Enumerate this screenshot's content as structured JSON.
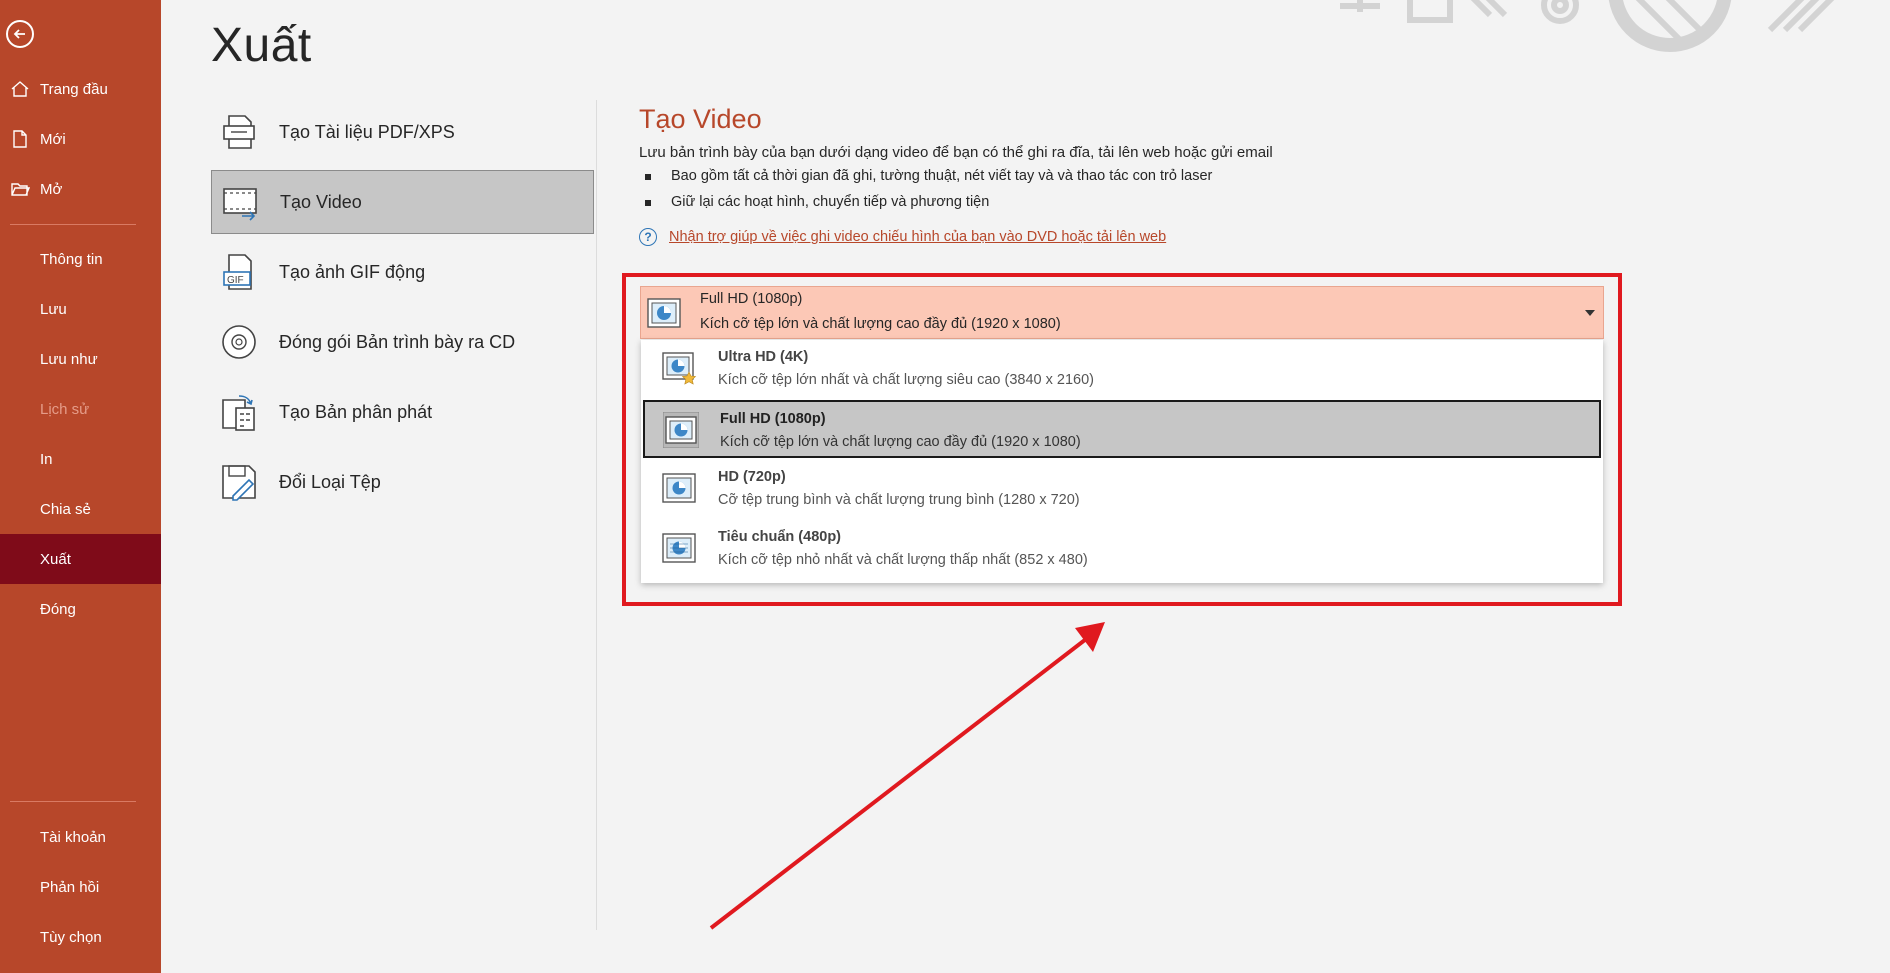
{
  "sidebar": {
    "back_label": "",
    "items": [
      {
        "label": "Trang đầu",
        "icon": "home-icon"
      },
      {
        "label": "Mới",
        "icon": "new-file-icon"
      },
      {
        "label": "Mở",
        "icon": "folder-open-icon"
      },
      {
        "label": "Thông tin"
      },
      {
        "label": "Lưu"
      },
      {
        "label": "Lưu như"
      },
      {
        "label": "Lịch sử",
        "disabled": true
      },
      {
        "label": "In"
      },
      {
        "label": "Chia sẻ"
      },
      {
        "label": "Xuất",
        "active": true
      },
      {
        "label": "Đóng"
      },
      {
        "label": "Tài khoản"
      },
      {
        "label": "Phản hồi"
      },
      {
        "label": "Tùy chọn"
      }
    ]
  },
  "page": {
    "title": "Xuất"
  },
  "export_options": [
    {
      "label": "Tạo Tài liệu PDF/XPS",
      "icon": "pdf-document-icon"
    },
    {
      "label": "Tạo Video",
      "icon": "video-icon",
      "selected": true
    },
    {
      "label": "Tạo ảnh GIF động",
      "icon": "gif-icon"
    },
    {
      "label": "Đóng gói Bản trình bày ra CD",
      "icon": "cd-icon"
    },
    {
      "label": "Tạo Bản phân phát",
      "icon": "handouts-icon"
    },
    {
      "label": "Đổi Loại Tệp",
      "icon": "change-file-type-icon"
    }
  ],
  "detail": {
    "title": "Tạo Video",
    "description": "Lưu bản trình bày của bạn dưới dạng video để bạn có thể ghi ra đĩa, tải lên web hoặc gửi email",
    "bullets": [
      "Bao gồm tất cả thời gian đã ghi, tường thuật, nét viết tay và và thao tác con trỏ laser",
      "Giữ lại các hoạt hình, chuyển tiếp và phương tiện"
    ],
    "help_link": "Nhận trợ giúp về việc ghi video chiếu hình của bạn vào DVD hoặc tải lên web"
  },
  "quality_dropdown": {
    "selected_title": "Full HD (1080p)",
    "selected_desc": "Kích cỡ tệp lớn và chất lượng cao đầy đủ (1920 x 1080)",
    "options": [
      {
        "title": "Ultra HD (4K)",
        "desc": "Kích cỡ tệp lớn nhất và chất lượng siêu cao (3840 x 2160)",
        "icon": "ultra-hd-icon"
      },
      {
        "title": "Full HD (1080p)",
        "desc": "Kích cỡ tệp lớn và chất lượng cao đầy đủ (1920 x 1080)",
        "icon": "full-hd-icon",
        "selected": true
      },
      {
        "title": "HD (720p)",
        "desc": "Cỡ tệp trung bình và chất lượng trung bình (1280 x 720)",
        "icon": "hd-icon"
      },
      {
        "title": "Tiêu chuẩn (480p)",
        "desc": "Kích cỡ tệp nhỏ nhất và chất lượng thấp nhất (852 x 480)",
        "icon": "standard-icon"
      }
    ]
  },
  "colors": {
    "sidebar_bg": "#b7472a",
    "sidebar_active": "#7f0b19",
    "accent": "#b7472a",
    "highlight_border": "#e0191f",
    "combo_bg": "#fcc8b6"
  }
}
